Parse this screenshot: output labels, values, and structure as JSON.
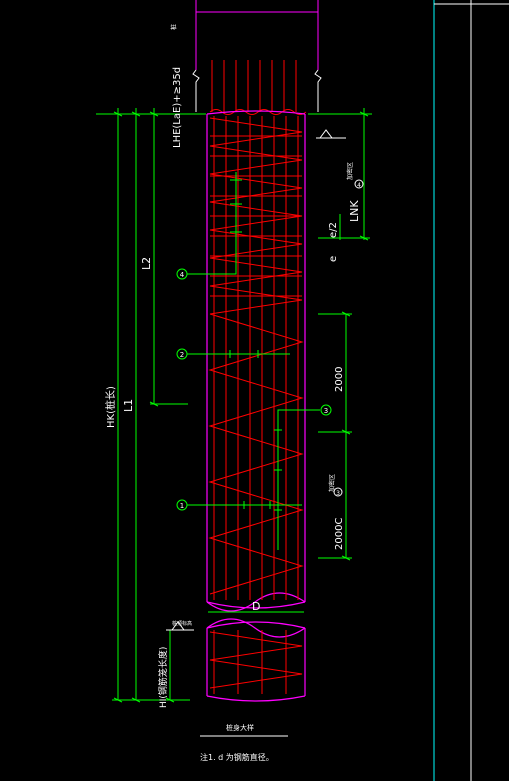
{
  "drawing": {
    "labels": {
      "lap_length": "LHE(LaE)+≥35d",
      "lnk": "LNK",
      "l2": "L2",
      "l1": "L1",
      "hk": "HK(桩长)",
      "hi": "HI(钢筋笼长度)",
      "spacing_half": "e/2",
      "spacing": "e",
      "dim_2000_a": "2000",
      "dim_2000_b": "2000C",
      "diameter": "D",
      "section_title": "桩身大样",
      "note": "注1. d  为钢筋直径。"
    },
    "callouts": {
      "c1": "1",
      "c2": "2",
      "c3": "3",
      "c3b": "3",
      "c4": "4",
      "c4b": "4"
    },
    "small_notes": {
      "top_a": "桩",
      "tag_right": "加密区",
      "tag_right_b": "加密区",
      "tag_left": "桩顶标高"
    },
    "colors": {
      "background": "#000000",
      "pile_outline": "#ff00ff",
      "rebar": "#ff0000",
      "dimension": "#00ff00",
      "text": "#ffffff",
      "frame_cyan": "#00ffff",
      "frame_white": "#ffffff"
    }
  }
}
